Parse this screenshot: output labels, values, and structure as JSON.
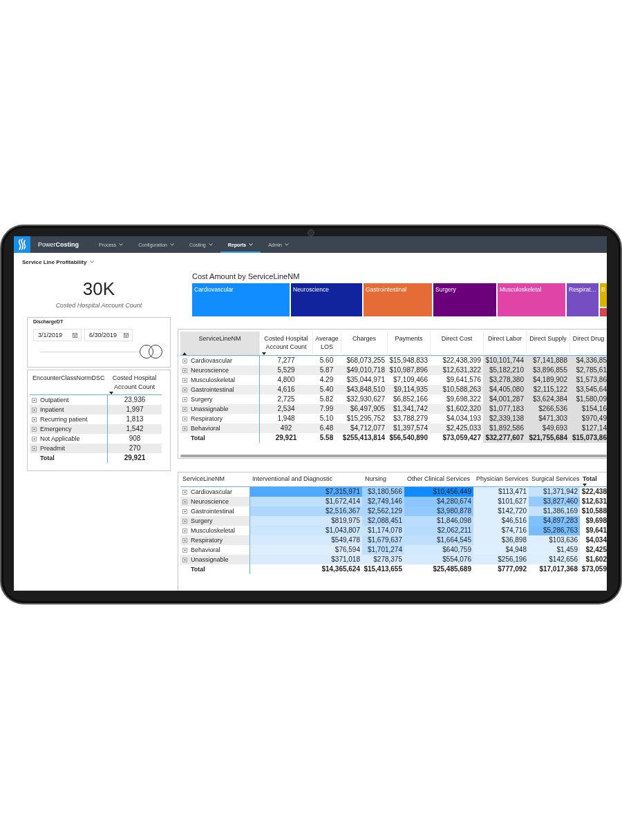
{
  "nav": {
    "brand": "Power**Costing**",
    "items": [
      {
        "label": "Process",
        "selected": false
      },
      {
        "label": "Configuration",
        "selected": false
      },
      {
        "label": "Costing",
        "selected": false
      },
      {
        "label": "Reports",
        "selected": true
      },
      {
        "label": "Admin",
        "selected": false
      }
    ]
  },
  "report_menu": {
    "label": "Service Line Profitability"
  },
  "kpi_card": {
    "value": "30K",
    "label": "Costed Hospital Account Count"
  },
  "date_slicer": {
    "title": "DischargeDT",
    "start_date": "3/1/2019",
    "end_date": "6/30/2019",
    "handles": [
      {
        "level": 0.92
      },
      {
        "level": 1
      }
    ]
  },
  "encounter_table": {
    "columns": [
      {
        "label": "EncounterClassNormDSC",
        "sorted": false
      },
      {
        "label": "Costed Hospital Account Count",
        "sorted": true,
        "descending": true
      }
    ],
    "rows": [
      {
        "label": "Outpatient",
        "value": "23,936"
      },
      {
        "label": "Inpatient",
        "value": "1,997"
      },
      {
        "label": "Recurring patient",
        "value": "1,813"
      },
      {
        "label": "Emergency",
        "value": "1,542"
      },
      {
        "label": "Not Applicable",
        "value": "908"
      },
      {
        "label": "Preadmit",
        "value": "270"
      }
    ],
    "total": {
      "label": "Total",
      "value": "29,921"
    }
  },
  "treemap": {
    "title": "Cost Amount by ServiceLineNM",
    "tiles": [
      {
        "label": "Cardiovascular",
        "color": "#118dff"
      },
      {
        "label": "Neuroscience",
        "color": "#12239e"
      },
      {
        "label": "Gastrointestinal",
        "color": "#e66c37"
      },
      {
        "label": "Surgery",
        "color": "#6b007b"
      },
      {
        "label": "Musculoskeletal",
        "color": "#e044a7"
      },
      {
        "label": "Respirat…",
        "color": "#744ec2"
      },
      {
        "label": "B",
        "color": "#d9b300"
      },
      {
        "color": "#d64550"
      }
    ]
  },
  "service_table": {
    "columns": [
      {
        "label": "ServiceLineNM",
        "sorted": true,
        "descending": false,
        "header_shaded": true,
        "body_shaded": false
      },
      {
        "label": "Costed Hospital Account Count",
        "sorted": true,
        "descending": true,
        "header_shaded": false,
        "body_shaded": false
      },
      {
        "label": "Average LOS",
        "sorted": false,
        "header_shaded": false,
        "body_shaded": false
      },
      {
        "label": "Charges",
        "sorted": false,
        "header_shaded": false,
        "body_shaded": false
      },
      {
        "label": "Payments",
        "sorted": false,
        "header_shaded": false,
        "body_shaded": false
      },
      {
        "label": "Direct Cost",
        "sorted": false,
        "header_shaded": false,
        "body_shaded": false
      },
      {
        "label": "Direct Labor",
        "sorted": false,
        "header_shaded": false,
        "body_shaded": true
      },
      {
        "label": "Direct Supply",
        "sorted": false,
        "header_shaded": false,
        "body_shaded": true
      },
      {
        "label": "Direct Drug",
        "sorted": false,
        "header_shaded": false,
        "body_shaded": true
      }
    ],
    "rows": [
      {
        "cells": [
          "Cardiovascular",
          "7,277",
          "5.60",
          "$68,073,255",
          "$15,948,833",
          "$22,438,399",
          "$10,101,744",
          "$7,141,888",
          "$4,336,85"
        ]
      },
      {
        "cells": [
          "Neuroscience",
          "5,529",
          "5.87",
          "$49,010,718",
          "$10,987,896",
          "$12,631,322",
          "$5,182,210",
          "$3,896,855",
          "$2,785,61"
        ]
      },
      {
        "cells": [
          "Musculoskeletal",
          "4,800",
          "4.29",
          "$35,044,971",
          "$7,109,466",
          "$9,641,576",
          "$3,278,380",
          "$4,189,902",
          "$1,573,86"
        ]
      },
      {
        "cells": [
          "Gastrointestinal",
          "4,616",
          "5.40",
          "$43,848,510",
          "$9,114,935",
          "$10,588,263",
          "$4,405,080",
          "$2,115,122",
          "$3,545,64"
        ]
      },
      {
        "cells": [
          "Surgery",
          "2,725",
          "5.82",
          "$32,930,627",
          "$6,852,166",
          "$9,698,322",
          "$4,001,287",
          "$3,624,384",
          "$1,580,09"
        ]
      },
      {
        "cells": [
          "Unassignable",
          "2,534",
          "7.99",
          "$6,497,905",
          "$1,341,742",
          "$1,602,320",
          "$1,077,183",
          "$266,536",
          "$154,16"
        ]
      },
      {
        "cells": [
          "Respiratory",
          "1,948",
          "5.10",
          "$15,295,752",
          "$3,788,279",
          "$4,034,193",
          "$2,339,138",
          "$471,303",
          "$970,49"
        ]
      },
      {
        "cells": [
          "Behavioral",
          "492",
          "6.48",
          "$4,712,077",
          "$1,397,574",
          "$2,425,033",
          "$1,892,586",
          "$49,693",
          "$127,14"
        ]
      }
    ],
    "total": [
      "Total",
      "29,921",
      "5.58",
      "$255,413,814",
      "$56,540,890",
      "$73,059,427",
      "$32,277,607",
      "$21,755,684",
      "$15,073,86"
    ]
  },
  "cost_matrix": {
    "columns": [
      {
        "label": "ServiceLineNM",
        "kind": "dimension",
        "sorted": false
      },
      {
        "label": "Interventional and Diagnostic",
        "kind": "measure",
        "sorted": false
      },
      {
        "label": "Nursing",
        "kind": "measure",
        "sorted": false
      },
      {
        "label": "Other Clinical Services",
        "kind": "measure",
        "sorted": false
      },
      {
        "label": "Physician Services",
        "kind": "measure",
        "sorted": false
      },
      {
        "label": "Surgical Services",
        "kind": "measure",
        "sorted": false
      },
      {
        "label": "Total",
        "kind": "total",
        "sorted": true,
        "descending": true
      }
    ],
    "rows": [
      {
        "cells": [
          {
            "text": "Cardiovascular"
          },
          {
            "text": "$7,315,971",
            "color": "#4fa9fe"
          },
          {
            "text": "$3,180,566",
            "color": "#a1d1fe"
          },
          {
            "text": "$10,456,449",
            "color": "#118bff"
          },
          {
            "text": "$113,471",
            "color": "#deeefd"
          },
          {
            "text": "$1,371,942",
            "color": "#c4e2fe"
          },
          {
            "text": "$22,438"
          }
        ]
      },
      {
        "cells": [
          {
            "text": "Neuroscience"
          },
          {
            "text": "$1,672,414",
            "color": "#bfdffd"
          },
          {
            "text": "$2,749,146",
            "color": "#aad5fe"
          },
          {
            "text": "$4,280,674",
            "color": "#8bc6fe"
          },
          {
            "text": "$101,627",
            "color": "#deeefd"
          },
          {
            "text": "$3,827,460",
            "color": "#94cafe"
          },
          {
            "text": "$12,631"
          }
        ]
      },
      {
        "cells": [
          {
            "text": "Gastrointestinal"
          },
          {
            "text": "$2,516,367",
            "color": "#aed7fd"
          },
          {
            "text": "$2,562,129",
            "color": "#add6fd"
          },
          {
            "text": "$3,980,878",
            "color": "#91c9fe"
          },
          {
            "text": "$142,720",
            "color": "#ddeefd"
          },
          {
            "text": "$1,386,169",
            "color": "#c4e2fd"
          },
          {
            "text": "$10,588"
          }
        ]
      },
      {
        "cells": [
          {
            "text": "Surgery"
          },
          {
            "text": "$819,975",
            "color": "#d0e7fd"
          },
          {
            "text": "$2,088,451",
            "color": "#b7dbfd"
          },
          {
            "text": "$1,846,098",
            "color": "#bbddfd"
          },
          {
            "text": "$46,516",
            "color": "#dfeefd"
          },
          {
            "text": "$4,897,283",
            "color": "#7fc0fe"
          },
          {
            "text": "$9,698"
          }
        ]
      },
      {
        "cells": [
          {
            "text": "Musculoskeletal"
          },
          {
            "text": "$1,043,807",
            "color": "#cbe5fd"
          },
          {
            "text": "$1,174,078",
            "color": "#c9e4fd"
          },
          {
            "text": "$2,062,211",
            "color": "#b7dbfd"
          },
          {
            "text": "$74,716",
            "color": "#dfeefd"
          },
          {
            "text": "$5,286,763",
            "color": "#77bcfe"
          },
          {
            "text": "$9,641"
          }
        ]
      },
      {
        "cells": [
          {
            "text": "Respiratory"
          },
          {
            "text": "$549,478",
            "color": "#d5eafd"
          },
          {
            "text": "$1,679,637",
            "color": "#bfdffd"
          },
          {
            "text": "$1,664,545",
            "color": "#bfdffd"
          },
          {
            "text": "$36,898",
            "color": "#dfeefd"
          },
          {
            "text": "$103,636",
            "color": "#deeefd"
          },
          {
            "text": "$4,034"
          }
        ]
      },
      {
        "cells": [
          {
            "text": "Behavioral"
          },
          {
            "text": "$76,594",
            "color": "#dfeefd"
          },
          {
            "text": "$1,701,274",
            "color": "#bedffd"
          },
          {
            "text": "$640,759",
            "color": "#d3e9fd"
          },
          {
            "text": "$4,948",
            "color": "#e0effd"
          },
          {
            "text": "$1,459",
            "color": "#e0effd"
          },
          {
            "text": "$2,425"
          }
        ]
      },
      {
        "cells": [
          {
            "text": "Unassignable"
          },
          {
            "text": "$371,018",
            "color": "#d9ebfd"
          },
          {
            "text": "$278,375",
            "color": "#daecfd"
          },
          {
            "text": "$554,076",
            "color": "#d5eafd"
          },
          {
            "text": "$256,196",
            "color": "#daecfd"
          },
          {
            "text": "$142,656",
            "color": "#ddeefd"
          },
          {
            "text": "$1,602"
          }
        ]
      }
    ],
    "total": {
      "cells": [
        {
          "text": "Total"
        },
        {
          "text": "$14,365,624"
        },
        {
          "text": "$15,413,655"
        },
        {
          "text": "$25,485,689"
        },
        {
          "text": "$777,092"
        },
        {
          "text": "$17,017,368"
        },
        {
          "text": "$73,059"
        }
      ]
    }
  }
}
